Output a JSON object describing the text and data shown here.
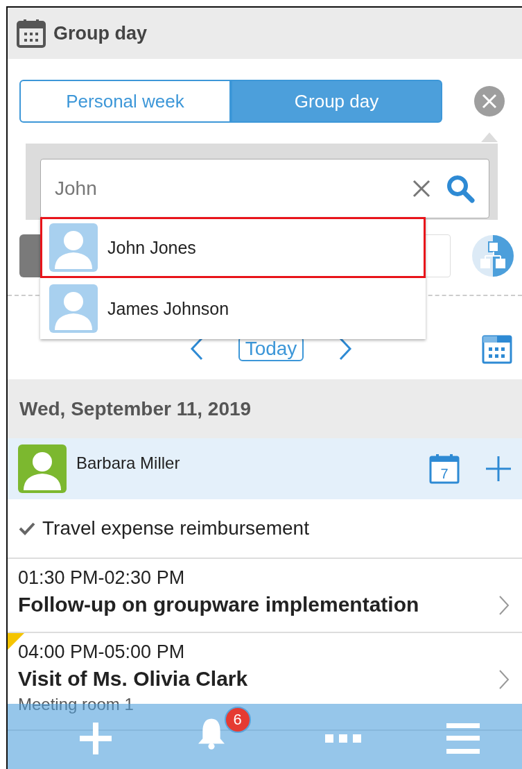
{
  "header": {
    "title": "Group day"
  },
  "tabs": [
    {
      "label": "Personal week",
      "selected": false
    },
    {
      "label": "Group day",
      "selected": true
    }
  ],
  "search": {
    "value": "John"
  },
  "suggestions": [
    {
      "name": "John Jones",
      "selected": true
    },
    {
      "name": "James Johnson",
      "selected": false
    }
  ],
  "nav": {
    "today": "Today"
  },
  "date": "Wed, September 11, 2019",
  "user": {
    "name": "Barbara Miller",
    "calendar_day": "7"
  },
  "all_day": [
    {
      "title": "Travel expense reimbursement"
    }
  ],
  "events": [
    {
      "time": "01:30 PM-02:30 PM",
      "title": "Follow-up on groupware implementation",
      "flagged": false
    },
    {
      "time": "04:00 PM-05:00 PM",
      "title": "Visit of Ms. Olivia Clark",
      "location": "Meeting room 1",
      "flagged": true
    }
  ],
  "bottom_bar": {
    "notification_count": "6"
  }
}
